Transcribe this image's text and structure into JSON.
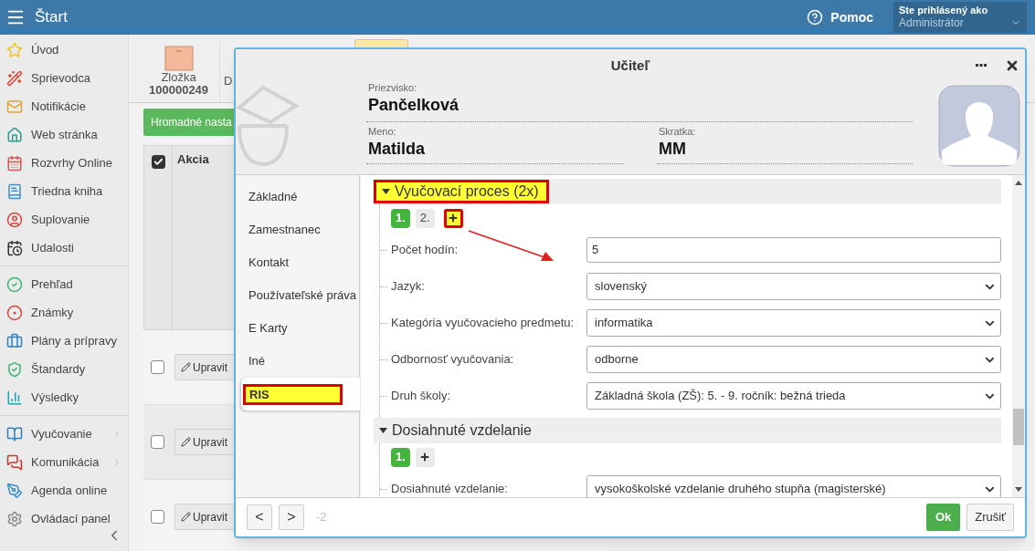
{
  "topbar": {
    "title": "Štart",
    "help": "Pomoc",
    "user_label": "Ste prihlásený ako",
    "user": "Administrátor"
  },
  "sidebar": {
    "groups": [
      {
        "items": [
          {
            "label": "Úvod",
            "has_arrow": false
          },
          {
            "label": "Sprievodca",
            "has_arrow": false
          },
          {
            "label": "Notifikácie",
            "has_arrow": false
          },
          {
            "label": "Web stránka",
            "has_arrow": false
          },
          {
            "label": "Rozvrhy Online",
            "has_arrow": false
          },
          {
            "label": "Triedna kniha",
            "has_arrow": false
          },
          {
            "label": "Suplovanie",
            "has_arrow": false
          },
          {
            "label": "Udalosti",
            "has_arrow": false
          }
        ]
      },
      {
        "items": [
          {
            "label": "Prehľad",
            "has_arrow": false
          },
          {
            "label": "Známky",
            "has_arrow": false
          },
          {
            "label": "Plány a prípravy",
            "has_arrow": false
          },
          {
            "label": "Štandardy",
            "has_arrow": false
          },
          {
            "label": "Výsledky",
            "has_arrow": false
          }
        ]
      },
      {
        "items": [
          {
            "label": "Vyučovanie",
            "has_arrow": true
          },
          {
            "label": "Komunikácia",
            "has_arrow": true
          },
          {
            "label": "Agenda online",
            "has_arrow": false
          },
          {
            "label": "Ovládací panel",
            "has_arrow": false
          }
        ]
      }
    ]
  },
  "background": {
    "toolbar": [
      {
        "label": "Zložka",
        "number": "100000249"
      },
      {
        "label": "D"
      }
    ],
    "bulk_button": "Hromadné nasta",
    "table": {
      "header_checked": true,
      "column": "Akcia",
      "rows": [
        {
          "checked": false,
          "action": "Upravit"
        },
        {
          "checked": false,
          "action": "Upravit"
        },
        {
          "checked": false,
          "action": "Upravit"
        }
      ]
    }
  },
  "dialog": {
    "title": "Učiteľ",
    "header_fields": [
      {
        "label": "Priezvisko:",
        "value": "Pančelková"
      },
      {
        "label": "Meno:",
        "value": "Matilda"
      },
      {
        "label": "Skratka:",
        "value": "MM"
      }
    ],
    "tabs": [
      {
        "label": "Základné",
        "selected": false,
        "highlighted": false
      },
      {
        "label": "Zamestnanec",
        "selected": false,
        "highlighted": false
      },
      {
        "label": "Kontakt",
        "selected": false,
        "highlighted": false
      },
      {
        "label": "Používateľské práva",
        "selected": false,
        "highlighted": false
      },
      {
        "label": "E Karty",
        "selected": false,
        "highlighted": false
      },
      {
        "label": "Iné",
        "selected": false,
        "highlighted": false
      },
      {
        "label": "RIS",
        "selected": true,
        "highlighted": true
      }
    ],
    "sections": [
      {
        "title": "Vyučovací proces (2x)",
        "expanded": true,
        "highlighted": true,
        "add_highlighted": true,
        "entries": [
          {
            "label": "1.",
            "selected": true
          },
          {
            "label": "2.",
            "selected": false
          }
        ],
        "fields": [
          {
            "label": "Počet hodín:",
            "kind": "input",
            "value": "5"
          },
          {
            "label": "Jazyk:",
            "kind": "select",
            "value": "slovenský"
          },
          {
            "label": "Kategória vyučovacieho predmetu:",
            "kind": "select",
            "value": "informatika"
          },
          {
            "label": "Odbornosť vyučovania:",
            "kind": "select",
            "value": "odborne"
          },
          {
            "label": "Druh školy:",
            "kind": "select",
            "value": "Základná škola (ZŠ): 5. - 9. ročník: bežná trieda"
          }
        ]
      },
      {
        "title": "Dosiahnuté vzdelanie",
        "expanded": true,
        "highlighted": false,
        "add_highlighted": false,
        "entries": [
          {
            "label": "1.",
            "selected": true
          }
        ],
        "fields": [
          {
            "label": "Dosiahnuté vzdelanie:",
            "kind": "select",
            "value": "vysokoškolské vzdelanie druhého stupňa (magisterské)"
          }
        ]
      }
    ],
    "footer": {
      "prev": "<",
      "next": ">",
      "counter": "-2",
      "ok": "Ok",
      "cancel": "Zrušiť"
    }
  }
}
